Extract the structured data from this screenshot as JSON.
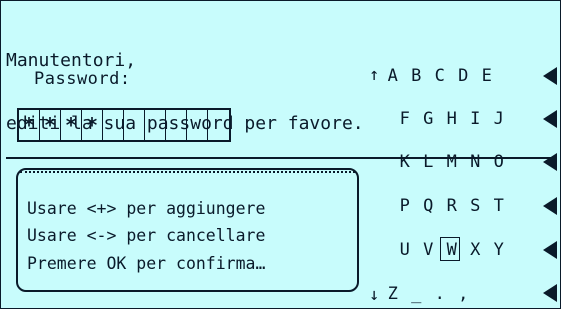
{
  "header": {
    "line1": "Manutentori,",
    "line2": "editi la sua password per favore."
  },
  "password": {
    "label": "Password:",
    "cells": [
      "*",
      "*",
      "*",
      "*",
      "",
      "",
      "",
      "",
      "",
      ""
    ]
  },
  "help": {
    "line1": "Usare <+> per aggiungere",
    "line2": "Usare <-> per cancellare",
    "line3": "Premere OK per confirma…"
  },
  "keyboard": {
    "up_arrow": "↑",
    "down_arrow": "↓",
    "rows": [
      [
        "A",
        "B",
        "C",
        "D",
        "E"
      ],
      [
        "F",
        "G",
        "H",
        "I",
        "J"
      ],
      [
        "K",
        "L",
        "M",
        "N",
        "O"
      ],
      [
        "P",
        "Q",
        "R",
        "S",
        "T"
      ],
      [
        "U",
        "V",
        "W",
        "X",
        "Y"
      ],
      [
        "Z",
        "_",
        ".",
        ","
      ]
    ],
    "selected_key": "W",
    "row_arrow_icon": "left-triangle-icon"
  },
  "colors": {
    "background": "#c8fcfc",
    "foreground": "#0a1a2a"
  }
}
